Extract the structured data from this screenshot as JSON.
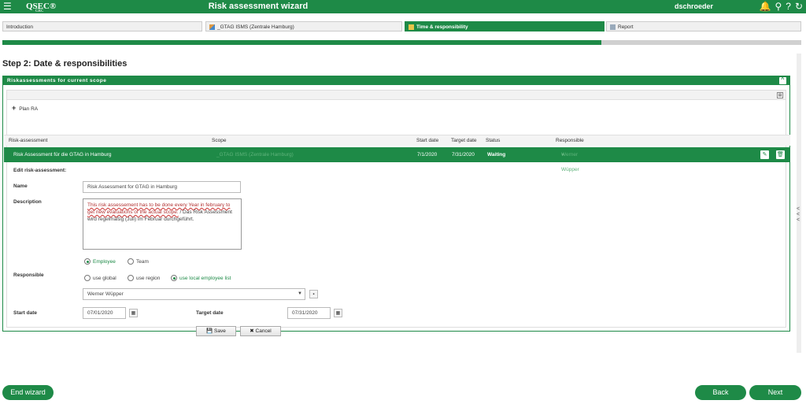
{
  "topbar": {
    "menu_icon": "hamburger-menu-icon",
    "logo": "QSEC®",
    "logo_sub": "GRC",
    "title": "Risk assessment wizard",
    "user": "dschroeder",
    "icons": [
      "bell-icon",
      "search-icon",
      "help-icon",
      "logout-icon"
    ]
  },
  "steps": [
    {
      "label": "Introduction"
    },
    {
      "label": "_GTAG ISMS (Zentrale Hamburg)"
    },
    {
      "label": "Time & responsibility"
    },
    {
      "label": "Report"
    }
  ],
  "progress": 0.75,
  "page_title": "Step 2: Date & responsibilities",
  "panel": {
    "title": "Riskassessments for current scope",
    "plan_label": "Plan RA",
    "columns": [
      "Risk-assessment",
      "Scope",
      "Start date",
      "Target date",
      "Status",
      "Responsible"
    ],
    "row": {
      "name": "Risk Assessment für die GTAG in Hamburg",
      "scope": "_GTAG ISMS (Zentrale Hamburg)",
      "start": "7/1/2020",
      "target": "7/31/2020",
      "status": "Waiting",
      "responsible": "Werner Wüpper"
    },
    "form": {
      "heading": "Edit risk-assessment:",
      "name_label": "Name",
      "name_value": "Risk Assessment for GTAG in Hamburg",
      "desc_label": "Description",
      "desc_part1": "This risk assessement has to be done every Year in february to get new evaluations of the actual scope.",
      "desc_part2": " / Das Risk Assessment wird regelmäßig (Juli) im Februar durchgeführt.",
      "radio_employee": "Employee",
      "radio_team": "Team",
      "responsible_label": "Responsible",
      "radio_global": "use global",
      "radio_region": "use region",
      "radio_local": "use local employee list",
      "responsible_value": "Werner Wüpper",
      "start_label": "Start date",
      "start_value": "07/01/2020",
      "target_label": "Target date",
      "target_value": "07/31/2020",
      "save": "Save",
      "cancel": "Cancel"
    }
  },
  "footer": {
    "end": "End wizard",
    "back": "Back",
    "next": "Next"
  },
  "colors": {
    "accent": "#1e8a47"
  }
}
